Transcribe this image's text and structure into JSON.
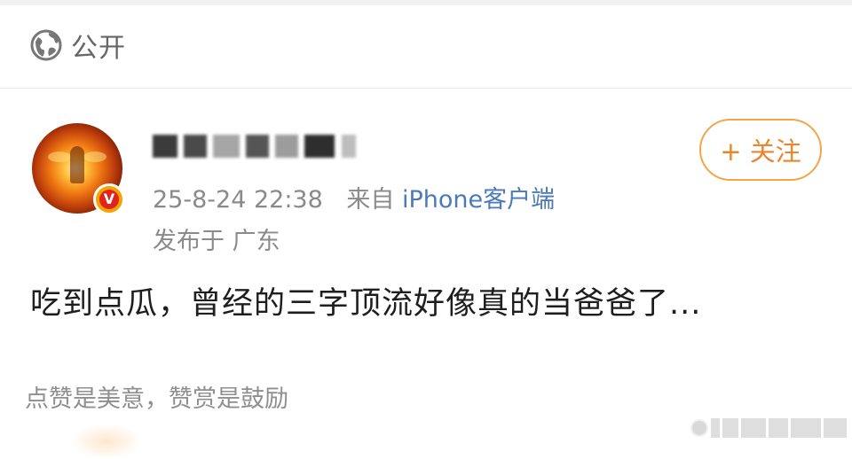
{
  "header": {
    "visibility_icon": "globe-icon",
    "visibility_label": "公开"
  },
  "author": {
    "avatar_icon": "avatar-image",
    "verified_icon": "verified-v-badge-icon",
    "verified_mark": "V",
    "username": "",
    "timestamp": "25-8-24 22:38",
    "source_prefix": "来自",
    "source_device": "iPhone客户端",
    "location": "发布于 广东"
  },
  "follow_button": {
    "label": "+ 关注"
  },
  "post": {
    "text": "吃到点瓜，曾经的三字顶流好像真的当爸爸了..."
  },
  "footer": {
    "reward_hint": "点赞是美意，赞赏是鼓励"
  },
  "colors": {
    "accent_orange": "#e9852a",
    "link_blue": "#4a7ab9",
    "meta_gray": "#8a8a8a",
    "verified_gold": "#f4a300",
    "verified_red": "#e0231c"
  }
}
